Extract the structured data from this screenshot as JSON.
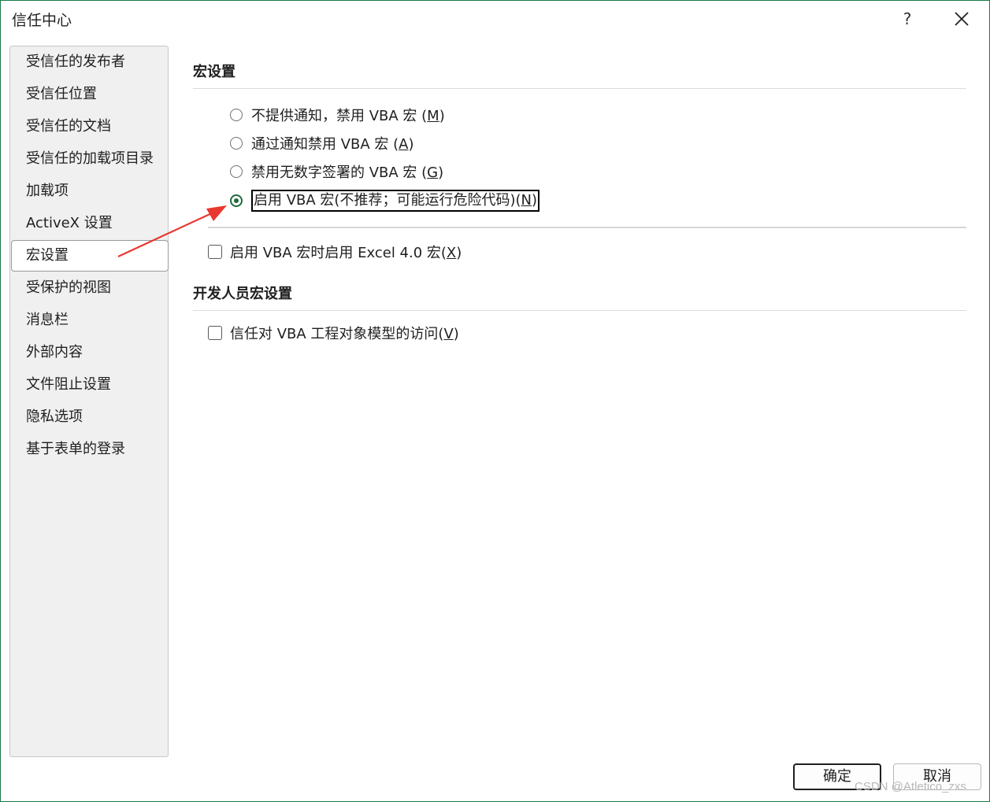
{
  "window": {
    "title": "信任中心",
    "help_label": "?",
    "close_icon": "close-icon",
    "accent_color": "#1e6b3c"
  },
  "sidebar": {
    "items": [
      {
        "label": "受信任的发布者",
        "selected": false
      },
      {
        "label": "受信任位置",
        "selected": false
      },
      {
        "label": "受信任的文档",
        "selected": false
      },
      {
        "label": "受信任的加载项目录",
        "selected": false
      },
      {
        "label": "加载项",
        "selected": false
      },
      {
        "label": "ActiveX 设置",
        "selected": false
      },
      {
        "label": "宏设置",
        "selected": true
      },
      {
        "label": "受保护的视图",
        "selected": false
      },
      {
        "label": "消息栏",
        "selected": false
      },
      {
        "label": "外部内容",
        "selected": false
      },
      {
        "label": "文件阻止设置",
        "selected": false
      },
      {
        "label": "隐私选项",
        "selected": false
      },
      {
        "label": "基于表单的登录",
        "selected": false
      }
    ]
  },
  "macro_settings": {
    "title": "宏设置",
    "options": [
      {
        "text": "不提供通知，禁用 VBA 宏 (",
        "key": "M",
        "close": ")",
        "checked": false
      },
      {
        "text": "通过通知禁用 VBA 宏 (",
        "key": "A",
        "close": ")",
        "checked": false
      },
      {
        "text": "禁用无数字签署的 VBA 宏 (",
        "key": "G",
        "close": ")",
        "checked": false
      },
      {
        "text": "启用 VBA 宏(不推荐；可能运行危险代码)(",
        "key": "N",
        "close": ")",
        "checked": true
      }
    ],
    "excel4": {
      "text": "启用 VBA 宏时启用 Excel 4.0 宏(",
      "key": "X",
      "close": ")",
      "checked": false
    }
  },
  "developer_settings": {
    "title": "开发人员宏设置",
    "trust_vba": {
      "text": "信任对 VBA 工程对象模型的访问(",
      "key": "V",
      "close": ")",
      "checked": false
    }
  },
  "footer": {
    "ok_label": "确定",
    "cancel_label": "取消"
  },
  "annotation": {
    "arrow_color": "#e8382f"
  },
  "watermark": "CSDN @Atletico_zxs"
}
